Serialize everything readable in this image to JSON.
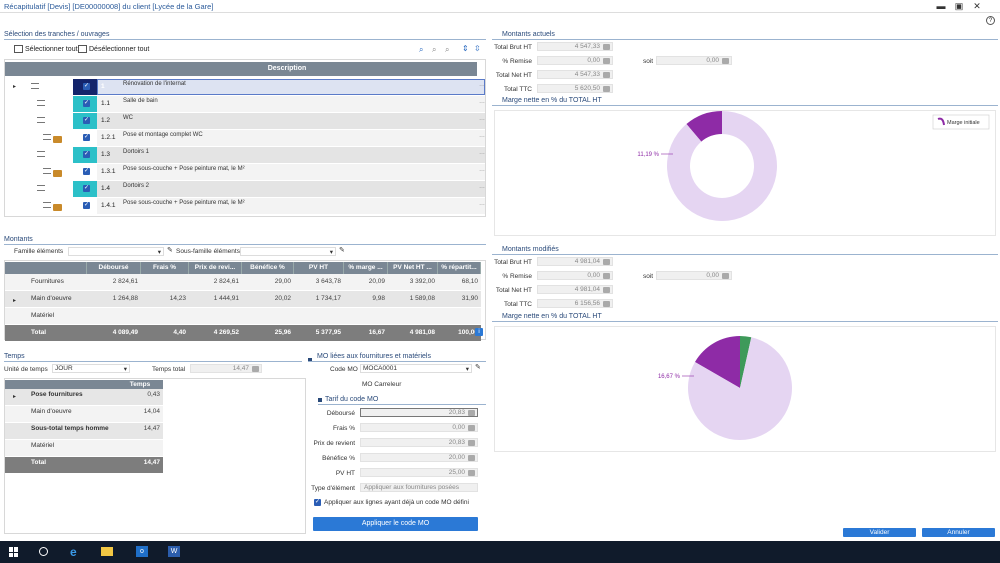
{
  "window": {
    "title": "Récapitulatif [Devis] [DE00000008] du client [Lycée de la Gare]"
  },
  "tranches": {
    "section_title": "Sélection des tranches / ouvrages",
    "select_all": "Sélectionner tout",
    "deselect_all": "Désélectionner tout",
    "col_description": "Description",
    "rows": [
      {
        "code": "1",
        "desc": "Rénovation de l'internat"
      },
      {
        "code": "1.1",
        "desc": "Salle de bain"
      },
      {
        "code": "1.2",
        "desc": "WC"
      },
      {
        "code": "1.2.1",
        "desc": "Pose et montage complet WC"
      },
      {
        "code": "1.3",
        "desc": "Dortoirs 1"
      },
      {
        "code": "1.3.1",
        "desc": "Pose sous-couche + Pose peinture mat, le M²"
      },
      {
        "code": "1.4",
        "desc": "Dortoirs 2"
      },
      {
        "code": "1.4.1",
        "desc": "Pose sous-couche + Pose peinture mat, le M²"
      }
    ]
  },
  "montants": {
    "section_title": "Montants",
    "famille_label": "Famille éléments",
    "sousfamille_label": "Sous-famille éléments",
    "headers": [
      "Déboursé",
      "Frais %",
      "Prix de revi...",
      "Bénéfice %",
      "PV HT",
      "% marge ...",
      "PV Net HT ...",
      "% répartit..."
    ],
    "rows": [
      {
        "label": "Fournitures",
        "values": [
          "2 824,61",
          "",
          "2 824,61",
          "29,00",
          "3 643,78",
          "20,09",
          "3 392,00",
          "68,10"
        ]
      },
      {
        "label": "Main d'oeuvre",
        "values": [
          "1 264,88",
          "14,23",
          "1 444,91",
          "20,02",
          "1 734,17",
          "9,98",
          "1 589,08",
          "31,90"
        ]
      },
      {
        "label": "Matériel",
        "values": [
          "",
          "",
          "",
          "",
          "",
          "",
          "",
          ""
        ]
      },
      {
        "label": "Total",
        "values": [
          "4 089,49",
          "4,40",
          "4 269,52",
          "25,96",
          "5 377,95",
          "16,67",
          "4 981,08",
          "100,00"
        ]
      }
    ]
  },
  "temps": {
    "section_title": "Temps",
    "unite_label": "Unité de temps",
    "unite_value": "JOUR",
    "total_label": "Temps total",
    "total_value": "14,47",
    "col_header": "Temps",
    "rows": [
      {
        "label": "Pose fournitures",
        "value": "0,43"
      },
      {
        "label": "Main d'oeuvre",
        "value": "14,04"
      },
      {
        "label": "Sous-total temps homme",
        "value": "14,47"
      },
      {
        "label": "Matériel",
        "value": ""
      },
      {
        "label": "Total",
        "value": "14,47"
      }
    ]
  },
  "mo": {
    "section_title": "MO liées aux fournitures et matériels",
    "code_label": "Code MO",
    "code_value": "MOCA0001",
    "code_desc": "MO Carreleur",
    "tarif_title": "Tarif du code MO",
    "fields": [
      {
        "label": "Déboursé",
        "value": "20,83"
      },
      {
        "label": "Frais %",
        "value": "0,00"
      },
      {
        "label": "Prix de revient",
        "value": "20,83"
      },
      {
        "label": "Bénéfice %",
        "value": "20,00"
      },
      {
        "label": "PV HT",
        "value": "25,00"
      }
    ],
    "type_label": "Type d'élément",
    "type_placeholder": "Appliquer aux fournitures posées",
    "checkbox_label": "Appliquer aux lignes ayant déjà un code MO défini",
    "apply_button": "Appliquer le code MO"
  },
  "actuels": {
    "section_title": "Montants actuels",
    "fields": [
      {
        "label": "Total Brut HT",
        "value": "4 547,33"
      },
      {
        "label": "% Remise",
        "value": "0,00"
      },
      {
        "label": "Total Net HT",
        "value": "4 547,33"
      },
      {
        "label": "Total TTC",
        "value": "5 620,50"
      }
    ],
    "soit_label": "soit",
    "soit_value": "0,00",
    "chart_title": "Marge nette en % du TOTAL HT"
  },
  "modifies": {
    "section_title": "Montants modifiés",
    "fields": [
      {
        "label": "Total Brut HT",
        "value": "4 981,04"
      },
      {
        "label": "% Remise",
        "value": "0,00"
      },
      {
        "label": "Total Net HT",
        "value": "4 981,04"
      },
      {
        "label": "Total TTC",
        "value": "6 156,56"
      }
    ],
    "soit_label": "soit",
    "soit_value": "0,00",
    "chart_title": "Marge nette en % du TOTAL HT"
  },
  "chart_data": [
    {
      "type": "pie",
      "categories": [
        "Marge initiale",
        ""
      ],
      "values": [
        11.19,
        88.81
      ],
      "labels": [
        "11,19 %"
      ],
      "legend": [
        "Marge initiale"
      ],
      "legend_position": "top-right",
      "colors": [
        "#8e2ba6",
        "#e5d5f2"
      ]
    },
    {
      "type": "pie",
      "categories": [
        "",
        "",
        ""
      ],
      "values": [
        16.67,
        3.5,
        79.83
      ],
      "labels": [
        "16,67 %"
      ],
      "colors": [
        "#8e2ba6",
        "#3e9a5a",
        "#e5d5f2"
      ]
    }
  ],
  "footer": {
    "validate": "Valider",
    "cancel": "Annuler"
  },
  "colors": {
    "accent": "#2b79d6",
    "teal": "#2cc0c8",
    "navy": "#13246b",
    "header": "#7a8794"
  }
}
